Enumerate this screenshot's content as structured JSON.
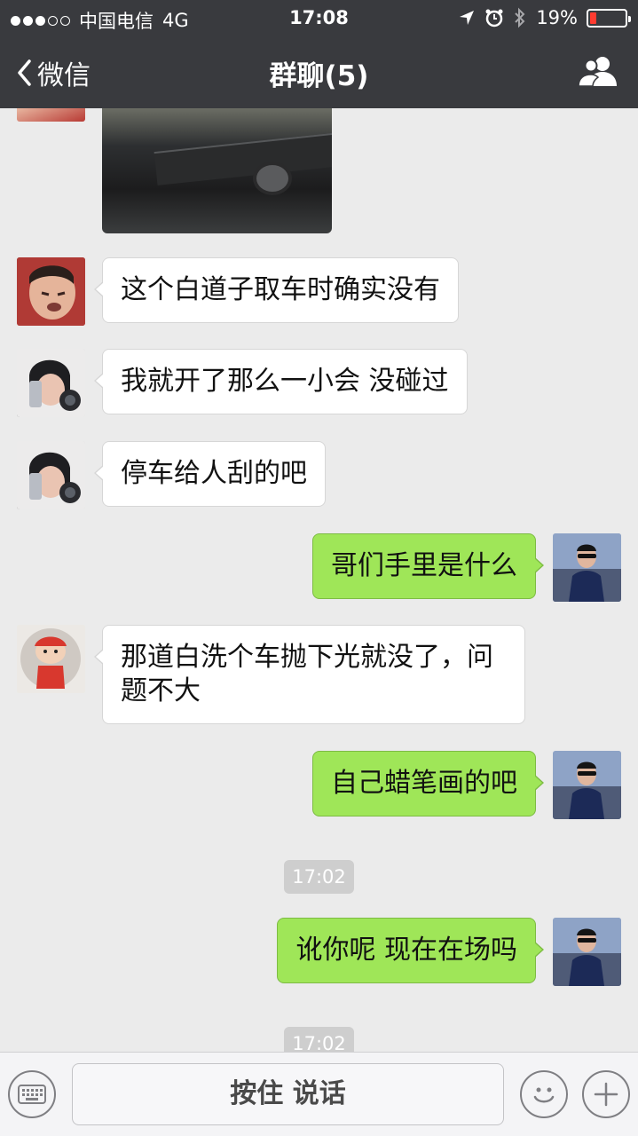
{
  "status_bar": {
    "carrier": "中国电信",
    "network": "4G",
    "time": "17:08",
    "battery": "19%",
    "battery_level": 0.19,
    "signal_bars_filled": 3,
    "signal_bars_total": 5
  },
  "nav": {
    "back_label": "微信",
    "title": "群聊(5)"
  },
  "messages": [
    {
      "side": "left",
      "type": "image"
    },
    {
      "side": "left",
      "text": "这个白道子取车时确实没有"
    },
    {
      "side": "left",
      "text": "我就开了那么一小会 没碰过"
    },
    {
      "side": "left",
      "text": "停车给人刮的吧"
    },
    {
      "side": "right",
      "text": "哥们手里是什么"
    },
    {
      "side": "left",
      "text": "那道白洗个车抛下光就没了，问题不大"
    },
    {
      "side": "right",
      "text": "自己蜡笔画的吧"
    },
    {
      "side": "system",
      "text": "17:02"
    },
    {
      "side": "right",
      "text": "讹你呢 现在在场吗"
    },
    {
      "side": "system",
      "text": "17:02"
    }
  ],
  "input_bar": {
    "talk_label": "按住 说话"
  },
  "colors": {
    "nav_bg": "#393a3e",
    "chat_bg": "#ebebeb",
    "bubble_self": "#9fe658",
    "bubble_other": "#ffffff"
  }
}
